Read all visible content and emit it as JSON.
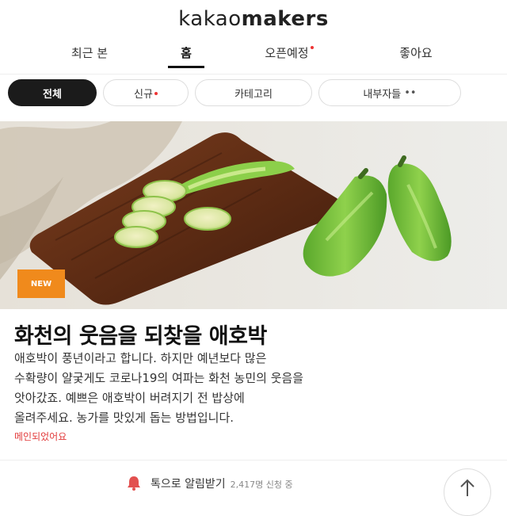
{
  "header": {
    "logo_part1": "kakao",
    "logo_part2": "makers"
  },
  "tabs": [
    {
      "label": "최근 본"
    },
    {
      "label": "홈"
    },
    {
      "label": "오픈예정"
    },
    {
      "label": "좋아요"
    }
  ],
  "chips": [
    {
      "label": "전체"
    },
    {
      "label": "신규"
    },
    {
      "label": "카테고리"
    },
    {
      "label": "내부자들"
    }
  ],
  "hero": {
    "badge": "NEW"
  },
  "article": {
    "title": "화천의 웃음을 되찾을 애호박",
    "desc_line1": "애호박이 풍년이라고 합니다. 하지만 예년보다 많은",
    "desc_line2": "수확량이 얄궂게도 코로나19의 여파는 화천 농민의 웃음을",
    "desc_line3": "앗아갔죠. 예쁘은 애호박이 버려지기 전 밥상에",
    "desc_line4": "올려주세요. 농가를 맛있게 돕는 방법입니다.",
    "link": "메인되었어요"
  },
  "bottom_bar": {
    "text": "톡으로 알림받기",
    "sub": "2,417명 신청 중"
  },
  "colors": {
    "accent_red": "#e23a3a",
    "badge_orange": "#f08a1c",
    "chip_active_bg": "#1b1b1b"
  }
}
